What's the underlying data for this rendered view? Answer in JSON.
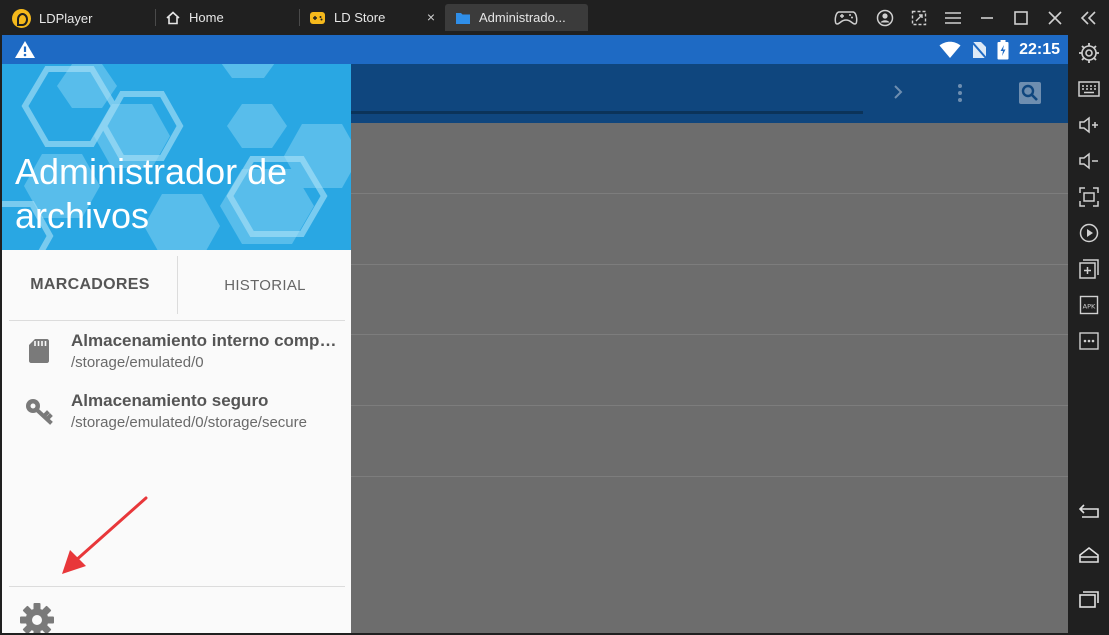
{
  "window": {
    "app_name": "LDPlayer",
    "tabs": [
      {
        "label": "Home"
      },
      {
        "label": "LD Store"
      },
      {
        "label": "Administrado..."
      }
    ],
    "close_glyph": "×"
  },
  "status_bar": {
    "time": "22:15",
    "icons": [
      "warning-icon",
      "wifi-icon",
      "no-sim-icon",
      "battery-charging-icon"
    ]
  },
  "app_bar": {
    "icons": [
      "chevron-right-icon",
      "more-vert-icon",
      "search-icon"
    ]
  },
  "drawer": {
    "title": "Administrador de archivos",
    "tabs": [
      "MARCADORES",
      "HISTORIAL"
    ],
    "storage": [
      {
        "name": "Almacenamiento interno compartido",
        "path": "/storage/emulated/0",
        "icon": "sd-card-icon"
      },
      {
        "name": "Almacenamiento seguro",
        "path": "/storage/emulated/0/storage/secure",
        "icon": "key-icon"
      }
    ],
    "footer_icon": "gear-icon"
  },
  "sidebar": {
    "icons": [
      "settings-icon",
      "keyboard-icon",
      "volume-up-icon",
      "volume-down-icon",
      "fullscreen-icon",
      "record-icon",
      "add-window-icon",
      "apk-icon",
      "more-icon",
      "back-icon",
      "home-icon",
      "recents-icon"
    ]
  },
  "colors": {
    "status_bar": "#1e6ac4",
    "app_bar": "#0f467e",
    "drawer_header": "#29a7e3",
    "annotation_arrow": "#e8373a"
  }
}
